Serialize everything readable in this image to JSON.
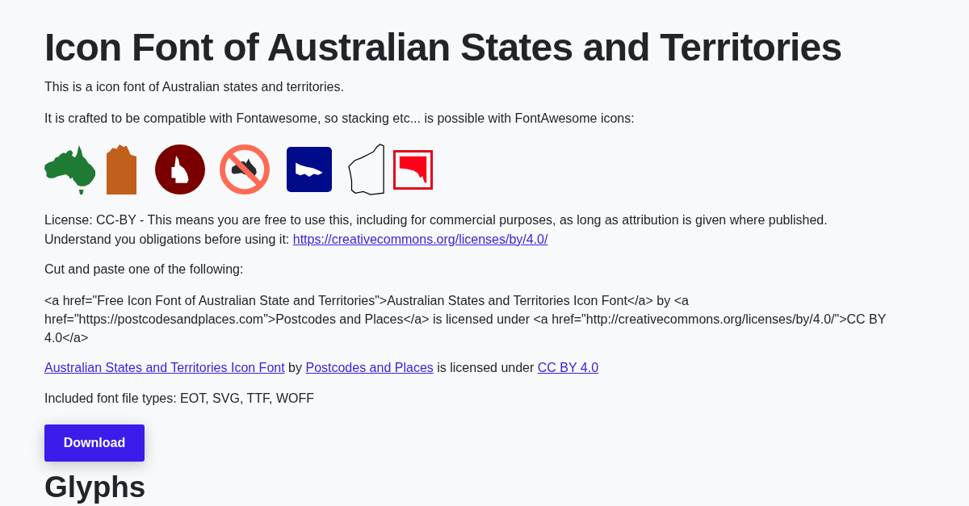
{
  "title": "Icon Font of Australian States and Territories",
  "intro": [
    "This is a icon font of Australian states and territories.",
    "It is crafted to be compatible with Fontawesome, so stacking etc... is possible with FontAwesome icons:"
  ],
  "license": {
    "text": "License: CC-BY - This means you are free to use this, including for commercial purposes, as long as attribution is given where published. Understand you obligations before using it:",
    "link": "https://creativecommons.org/licenses/by/4.0/"
  },
  "cut_paste_label": "Cut and paste one of the following:",
  "code_snippet": "<a href=\"Free Icon Font of Australian State and Territories\">Australian States and Territories Icon Font</a> by <a href=\"https://postcodesandplaces.com\">Postcodes and Places</a> is licensed under <a href=\"http://creativecommons.org/licenses/by/4.0/\">CC BY 4.0</a>",
  "attribution": [
    {
      "kind": "link",
      "text": "Australian States and Territories Icon Font"
    },
    {
      "kind": "text",
      "text": "by"
    },
    {
      "kind": "link",
      "text": "Postcodes and Places"
    },
    {
      "kind": "text",
      "text": "is licensed under"
    },
    {
      "kind": "link",
      "text": "CC BY 4.0"
    }
  ],
  "file_types": "Included font file types: EOT, SVG, TTF, WOFF",
  "download_button": "Download",
  "section_heading": "Glyphs"
}
